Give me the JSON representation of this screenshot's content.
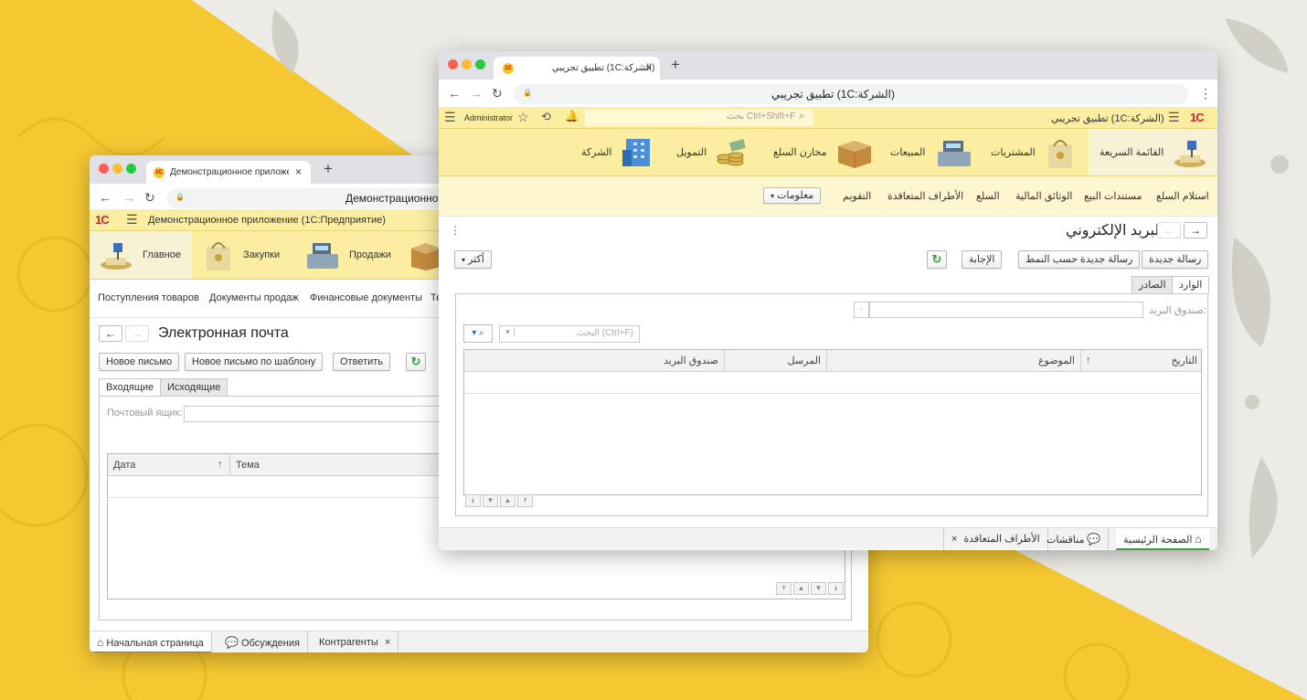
{
  "colors": {
    "background_yellow": "#f5c832",
    "ornament_gray": "#c9c6bd",
    "header_yellow": "#fbeea1",
    "accent_green": "#3aa03a",
    "brand_red": "#d2212d"
  },
  "ru_window": {
    "browser_tab_title": "Демонстрационное приложе",
    "address_text": "Демонстрационно",
    "logo_text": "1С",
    "app_title": "Демонстрационное приложение  (1С:Предприятие)",
    "sections": [
      {
        "label": "Главное",
        "icon": "quick-menu-icon"
      },
      {
        "label": "Закупки",
        "icon": "purchases-bag-icon"
      },
      {
        "label": "Продажи",
        "icon": "cash-register-icon"
      }
    ],
    "commands": [
      "Поступления товаров",
      "Документы продаж",
      "Финансовые документы",
      "Те"
    ],
    "form_title": "Электронная почта",
    "buttons": {
      "new_letter": "Новое письмо",
      "new_by_template": "Новое письмо по шаблону",
      "reply": "Ответить"
    },
    "tabs": {
      "incoming": "Входящие",
      "outgoing": "Исходящие"
    },
    "mailbox_label": "Почтовый ящик:",
    "columns": {
      "date": "Дата",
      "subject": "Тема",
      "sort_arrow": "↑"
    },
    "bottom_tabs": {
      "home": "Начальная страница",
      "discussions": "Обсуждения",
      "counterparties": "Контрагенты"
    }
  },
  "ar_window": {
    "browser_tab_title": "تطبيق تجريبي (1C:الشركة)",
    "address_text": "تطبيق تجريبي (1C:الشركة)",
    "logo_text": "1С",
    "user": "Administrator",
    "search_placeholder": "بحث Ctrl+Shift+F",
    "app_title": "تطبيق تجريبي  (1C:الشركة)",
    "sections": [
      {
        "label": "القائمة السريعة",
        "icon": "quick-menu-icon"
      },
      {
        "label": "المشتريات",
        "icon": "purchases-bag-icon"
      },
      {
        "label": "المبيعات",
        "icon": "cash-register-icon"
      },
      {
        "label": "مخازن السلع",
        "icon": "warehouse-box-icon"
      },
      {
        "label": "التمويل",
        "icon": "coins-icon"
      },
      {
        "label": "الشركة",
        "icon": "company-building-icon"
      }
    ],
    "commands": [
      "استلام السلع",
      "مستندات البيع",
      "الوثائق المالية",
      "السلع",
      "الأطراف المتعاقدة",
      "التقويم"
    ],
    "info_menu": "معلومات",
    "form_title": "البريد الإلكتروني",
    "buttons": {
      "new_letter": "رسالة جديدة",
      "new_by_template": "رسالة جديدة حسب النمط",
      "reply": "الإجابة",
      "more": "أكثر"
    },
    "tabs": {
      "incoming": "الوارد",
      "outgoing": "الصادر"
    },
    "mailbox_label": "صندوق البريد:",
    "search_placeholder_table": "البحث (Ctrl+F)",
    "columns": {
      "date": "التاريخ",
      "subject": "الموضوع",
      "sender": "المرسل",
      "mailbox": "صندوق البريد",
      "sort_arrow": "↑"
    },
    "bottom_tabs": {
      "home": "الصفحة الرئيسية",
      "discussions": "مناقشات",
      "counterparties": "الأطراف المتعاقدة"
    }
  }
}
